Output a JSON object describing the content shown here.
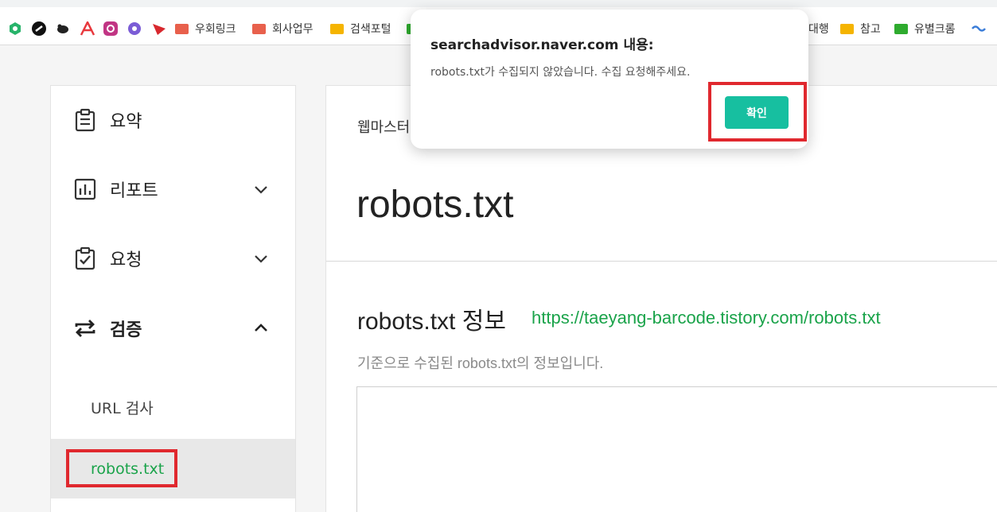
{
  "bookmarks": {
    "items": [
      {
        "label": "우회링크",
        "color": "#e8604c"
      },
      {
        "label": "회사업무",
        "color": "#e8604c"
      },
      {
        "label": "검색포털",
        "color": "#f5b400"
      },
      {
        "label": "대행",
        "color": "#2eab2e"
      },
      {
        "label": "참고",
        "color": "#f5b400"
      },
      {
        "label": "유별크롬",
        "color": "#2eab2e"
      }
    ]
  },
  "sidebar": {
    "items": [
      {
        "label": "요약",
        "icon": "clipboard-icon"
      },
      {
        "label": "리포트",
        "icon": "bar-chart-icon",
        "expanded": false
      },
      {
        "label": "요청",
        "icon": "clipboard-check-icon",
        "expanded": false
      },
      {
        "label": "검증",
        "icon": "repeat-icon",
        "expanded": true
      }
    ],
    "subitems": [
      {
        "label": "URL 검사"
      },
      {
        "label": "robots.txt",
        "active": true
      }
    ]
  },
  "main": {
    "breadcrumb": "웹마스터",
    "title": "robots.txt",
    "section_title": "robots.txt 정보",
    "section_link": "https://taeyang-barcode.tistory.com/robots.txt",
    "section_desc": "기준으로 수집된 robots.txt의 정보입니다."
  },
  "dialog": {
    "title": "searchadvisor.naver.com 내용:",
    "message": "robots.txt가 수집되지 않았습니다. 수집 요청해주세요.",
    "ok_label": "확인"
  },
  "colors": {
    "accent_green": "#1aa34a",
    "dialog_button": "#17bfa0",
    "highlight_red": "#e0282e"
  }
}
